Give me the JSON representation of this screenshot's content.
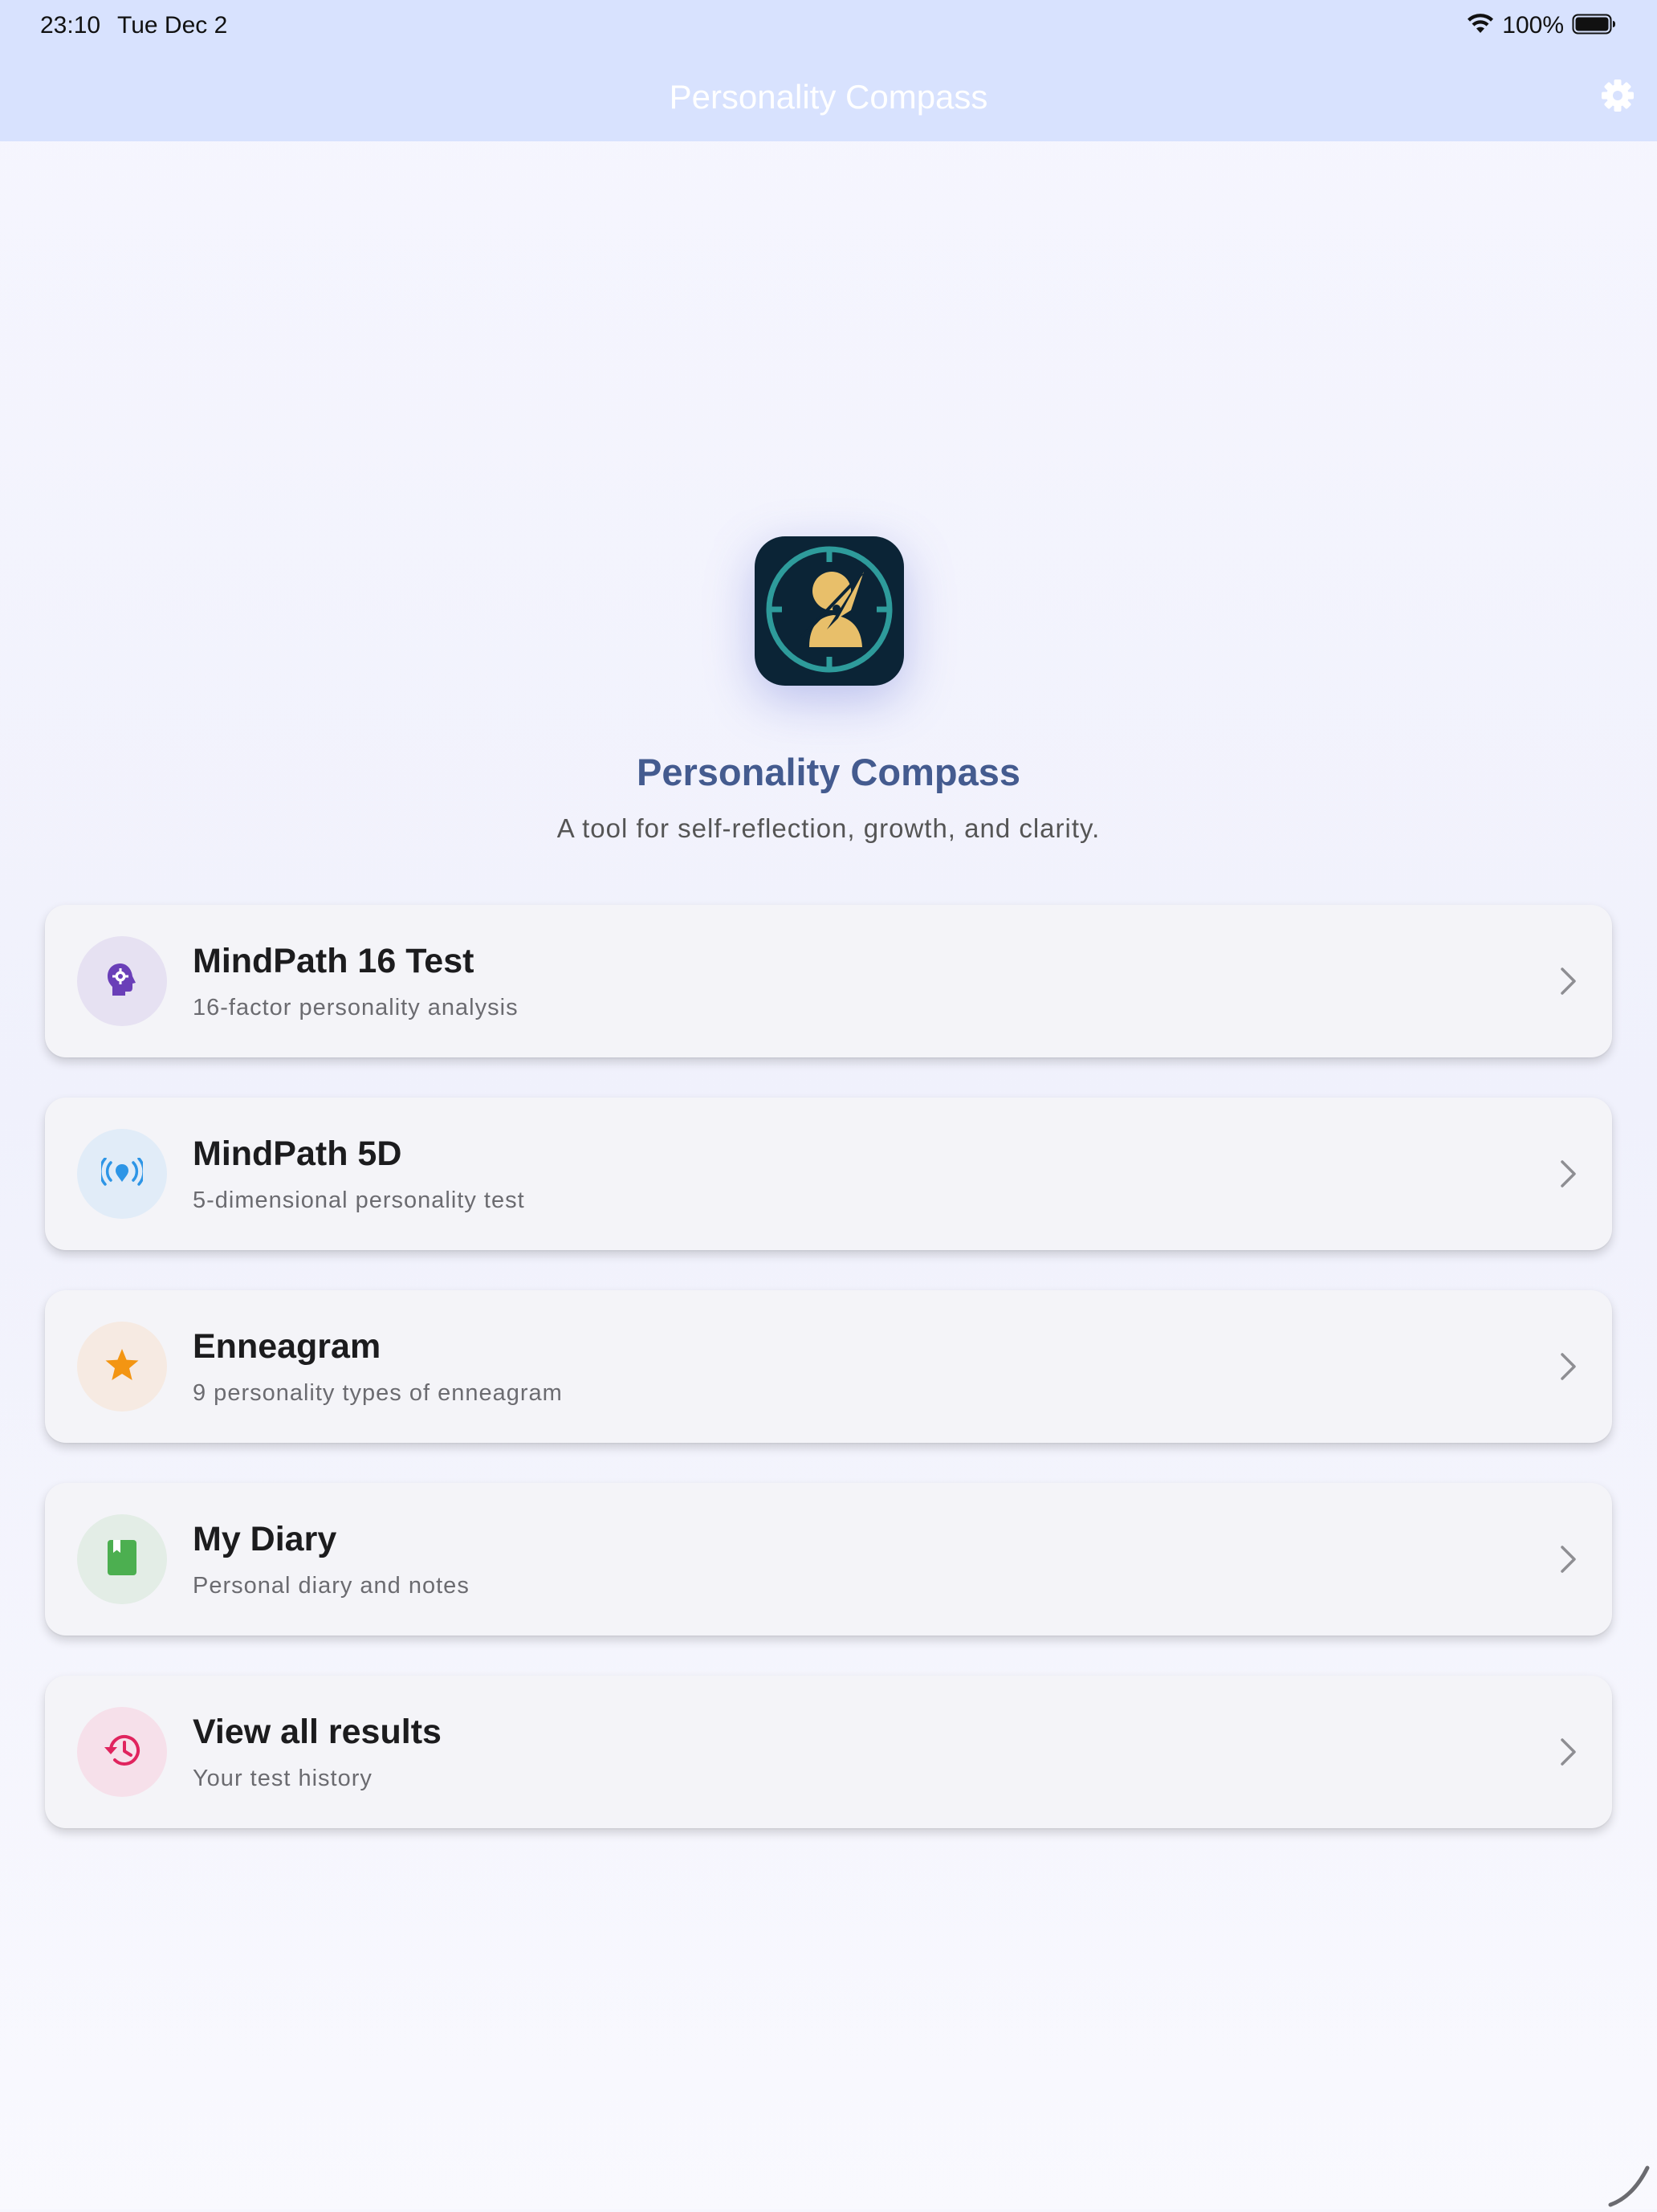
{
  "status_bar": {
    "time": "23:10",
    "date": "Tue Dec 2",
    "battery": "100%"
  },
  "nav": {
    "title": "Personality Compass",
    "settings_icon": "gear-icon"
  },
  "hero": {
    "title": "Personality Compass",
    "subtitle": "A tool for self-reflection, growth, and clarity."
  },
  "cards": [
    {
      "title": "MindPath 16 Test",
      "subtitle": "16-factor personality analysis",
      "icon": "head-gear-icon",
      "icon_color": "#6a3fb8",
      "icon_bg": "#e6e1f2"
    },
    {
      "title": "MindPath 5D",
      "subtitle": "5-dimensional personality test",
      "icon": "broadcast-icon",
      "icon_color": "#2d95e6",
      "icon_bg": "#e1ecf8"
    },
    {
      "title": "Enneagram",
      "subtitle": "9 personality types of enneagram",
      "icon": "star-icon",
      "icon_color": "#f39512",
      "icon_bg": "#f6eae2"
    },
    {
      "title": "My Diary",
      "subtitle": "Personal diary and notes",
      "icon": "book-icon",
      "icon_color": "#4caf50",
      "icon_bg": "#e3ede6"
    },
    {
      "title": "View all results",
      "subtitle": "Your test history",
      "icon": "history-icon",
      "icon_color": "#e0245e",
      "icon_bg": "#f6e0ea"
    }
  ],
  "colors": {
    "header_bg": "#d8e2fe",
    "title_accent": "#445b8f",
    "logo_bg": "#0b2436",
    "logo_ring": "#2e9b9b",
    "logo_figure": "#e8bf6a"
  }
}
